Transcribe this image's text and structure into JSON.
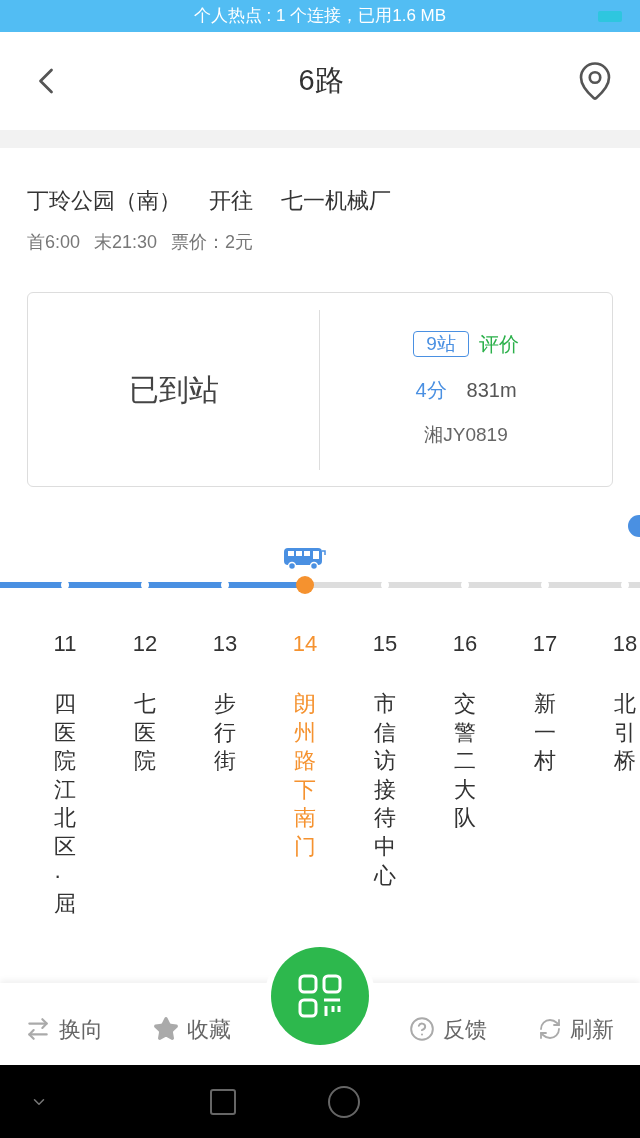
{
  "status_bar": {
    "text": "个人热点 : 1 个连接，已用1.6 MB"
  },
  "header": {
    "title": "6路"
  },
  "route": {
    "from": "丁玲公园（南）",
    "direction": "开往",
    "to": "七一机械厂",
    "first_bus": "首6:00",
    "last_bus": "末21:30",
    "fare": "票价：2元"
  },
  "arrival": {
    "status": "已到站",
    "stops": "9站",
    "rate": "评价",
    "minutes": "4分",
    "distance": "831m",
    "plate": "湘JY0819"
  },
  "stations": [
    {
      "number": "11",
      "name": "四医院江北区·屈",
      "passed": true,
      "selected": false
    },
    {
      "number": "12",
      "name": "七医院",
      "passed": true,
      "selected": false
    },
    {
      "number": "13",
      "name": "步行街",
      "passed": true,
      "selected": false
    },
    {
      "number": "14",
      "name": "朗州路下南门",
      "passed": false,
      "selected": true
    },
    {
      "number": "15",
      "name": "市信访接待中心",
      "passed": false,
      "selected": false
    },
    {
      "number": "16",
      "name": "交警二大队",
      "passed": false,
      "selected": false
    },
    {
      "number": "17",
      "name": "新一村",
      "passed": false,
      "selected": false
    },
    {
      "number": "18",
      "name": "北引桥",
      "passed": false,
      "selected": false
    }
  ],
  "bottom_bar": [
    {
      "kind": "swap",
      "label": "换向"
    },
    {
      "kind": "star",
      "label": "收藏"
    },
    {
      "kind": "scan"
    },
    {
      "kind": "help",
      "label": "反馈"
    },
    {
      "kind": "refresh",
      "label": "刷新"
    }
  ]
}
